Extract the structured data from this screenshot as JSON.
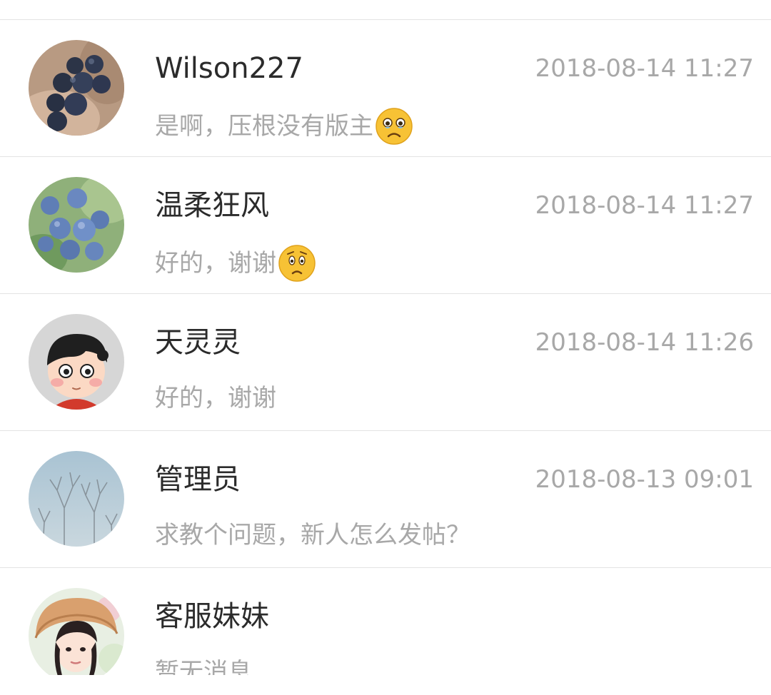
{
  "conversations": [
    {
      "name": "Wilson227",
      "time": "2018-08-14 11:27",
      "message": "是啊，压根没有版主",
      "emoji": "crying-face-emoji",
      "avatar": "blueberries-in-hand-avatar"
    },
    {
      "name": "温柔狂风",
      "time": "2018-08-14 11:27",
      "message": "好的，谢谢",
      "emoji": "worried-face-emoji",
      "avatar": "blueberry-bush-avatar"
    },
    {
      "name": "天灵灵",
      "time": "2018-08-14 11:26",
      "message": "好的，谢谢",
      "avatar": "cartoon-boy-avatar"
    },
    {
      "name": "管理员",
      "time": "2018-08-13 09:01",
      "message": "求教个问题，新人怎么发帖？",
      "avatar": "bare-tree-sky-avatar"
    },
    {
      "name": "客服妹妹",
      "time": "",
      "message": "暂无消息",
      "avatar": "girl-straw-hat-avatar"
    }
  ],
  "colors": {
    "name_text": "#2b2b2b",
    "secondary_text": "#a8a8a8",
    "divider": "#e3e3e3",
    "background": "#ffffff"
  }
}
